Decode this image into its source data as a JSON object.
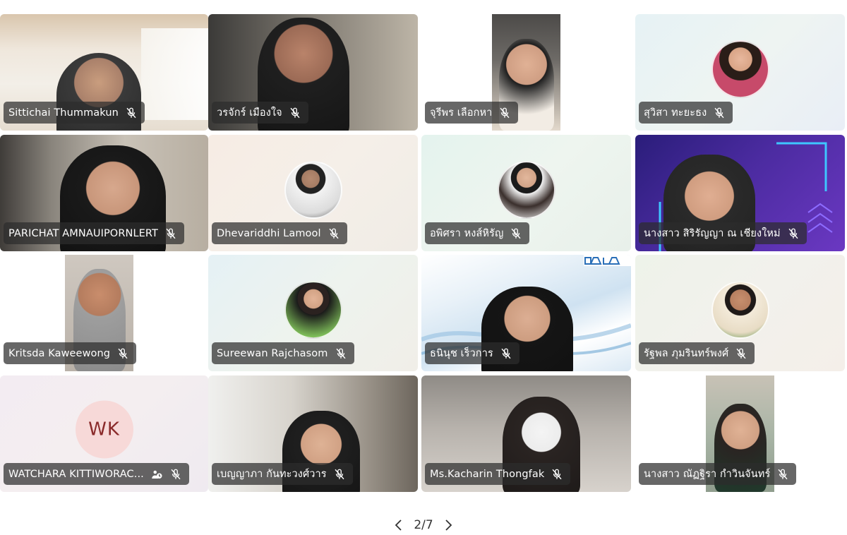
{
  "participants": [
    {
      "name": "Sittichai Thummakun",
      "muted": true
    },
    {
      "name": "วรจักร์ เมืองใจ",
      "muted": true
    },
    {
      "name": "จุรีพร เลือกหา",
      "muted": true
    },
    {
      "name": "สุวิสา ทะยะธง",
      "muted": true
    },
    {
      "name": "PARICHAT AMNAUIPORNLERT",
      "muted": true
    },
    {
      "name": "Dhevariddhi Lamool",
      "muted": true
    },
    {
      "name": "อพิศรา หงส์หิรัญ",
      "muted": true
    },
    {
      "name": "นางสาว สิริรัญญา ณ เชียงใหม่",
      "muted": true
    },
    {
      "name": "Kritsda Kaweewong",
      "muted": true
    },
    {
      "name": "Sureewan Rajchasom",
      "muted": true
    },
    {
      "name": "ธนินุช เร็วการ",
      "muted": true
    },
    {
      "name": "รัฐพล ภุมรินทร์พงศ์",
      "muted": true
    },
    {
      "name": "WATCHARA KITTIWORAC...",
      "muted": true,
      "initials": "WK"
    },
    {
      "name": "เบญญาภา กันทะวงศ์วาร",
      "muted": true
    },
    {
      "name": "Ms.Kacharin Thongfak",
      "muted": true
    },
    {
      "name": "นางสาว ณัฏฐิรา กำวินจันทร์",
      "muted": true
    }
  ],
  "pager": {
    "label": "2/7"
  }
}
